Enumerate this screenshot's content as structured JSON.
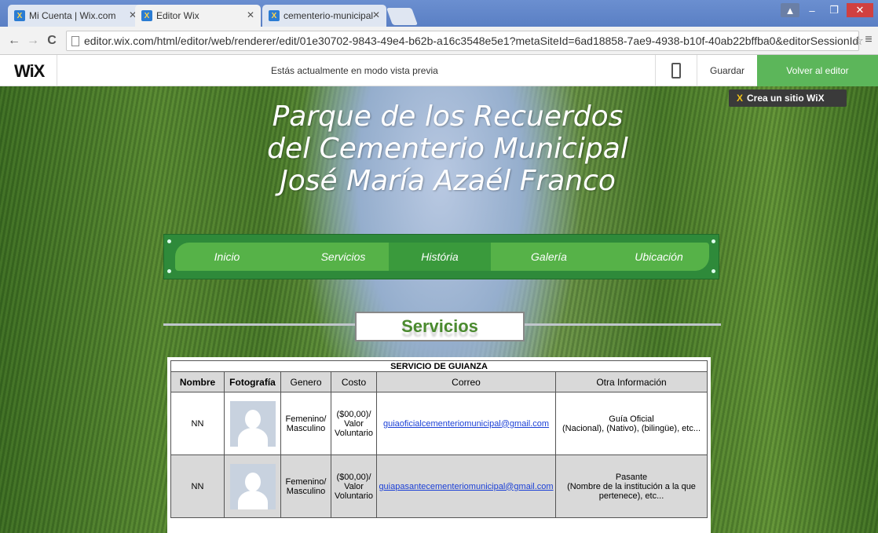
{
  "browser": {
    "tabs": [
      {
        "title": "Mi Cuenta | Wix.com",
        "active": false
      },
      {
        "title": "Editor Wix",
        "active": true
      },
      {
        "title": "cementerio-municipal",
        "active": false
      }
    ],
    "url": "editor.wix.com/html/editor/web/renderer/edit/01e30702-9843-49e4-b62b-a16c3548e5e1?metaSiteId=6ad18858-7ae9-4938-b10f-40ab22bffba0&editorSessionId=D4CE!",
    "window_controls": {
      "minimize": "–",
      "maximize": "❐",
      "close": "✕"
    }
  },
  "wixbar": {
    "logo": "WiX",
    "preview_message": "Estás actualmente en modo vista previa",
    "save_label": "Guardar",
    "back_label": "Volver al editor"
  },
  "site": {
    "badge": "Crea un sitio WiX",
    "title": "Parque de los Recuerdos del Cementerio Municipal José María Azaél  Franco",
    "nav": [
      "Inicio",
      "Servicios",
      "História",
      "Galería",
      "Ubicación"
    ],
    "section_title": "Servicios",
    "table": {
      "caption": "SERVICIO DE GUIANZA",
      "headers": [
        "Nombre",
        "Fotografía",
        "Genero",
        "Costo",
        "Correo",
        "Otra Información"
      ],
      "rows": [
        {
          "nombre": "NN",
          "genero": "Femenino/ Masculino",
          "costo": "($00,00)/ Valor Voluntario",
          "correo": "guiaoficialcementeriomunicipal@gmail.com",
          "info_title": "Guía Oficial",
          "info_detail": "(Nacional), (Nativo), (bilingüe), etc..."
        },
        {
          "nombre": "NN",
          "genero": "Femenino/ Masculino",
          "costo": "($00,00)/ Valor Voluntario",
          "correo": "guiapasantecementeriomunicipal@gmail.com",
          "info_title": "Pasante",
          "info_detail": "(Nombre de la institución a la que pertenece), etc..."
        }
      ]
    }
  }
}
